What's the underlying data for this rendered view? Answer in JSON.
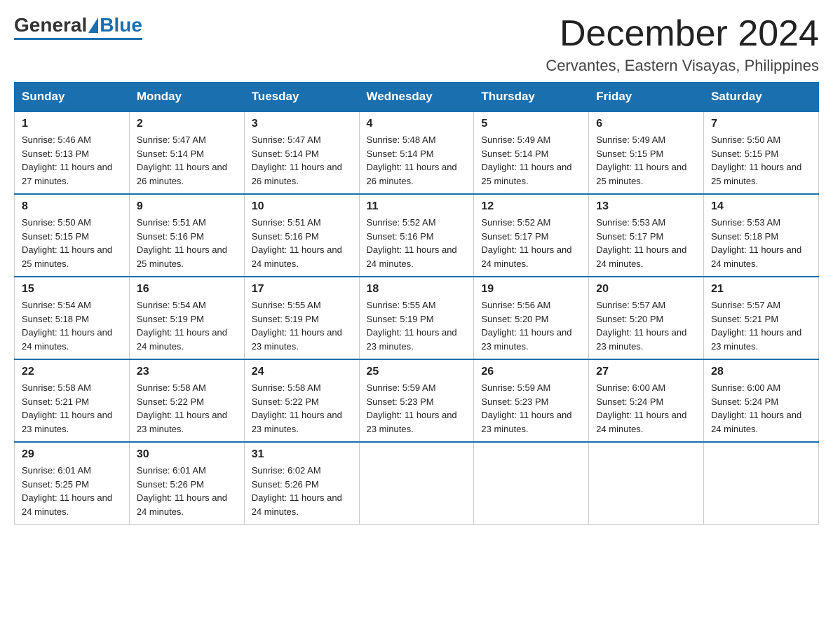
{
  "logo": {
    "general": "General",
    "blue": "Blue"
  },
  "title": "December 2024",
  "subtitle": "Cervantes, Eastern Visayas, Philippines",
  "days_of_week": [
    "Sunday",
    "Monday",
    "Tuesday",
    "Wednesday",
    "Thursday",
    "Friday",
    "Saturday"
  ],
  "weeks": [
    [
      {
        "day": "1",
        "sunrise": "5:46 AM",
        "sunset": "5:13 PM",
        "daylight": "11 hours and 27 minutes."
      },
      {
        "day": "2",
        "sunrise": "5:47 AM",
        "sunset": "5:14 PM",
        "daylight": "11 hours and 26 minutes."
      },
      {
        "day": "3",
        "sunrise": "5:47 AM",
        "sunset": "5:14 PM",
        "daylight": "11 hours and 26 minutes."
      },
      {
        "day": "4",
        "sunrise": "5:48 AM",
        "sunset": "5:14 PM",
        "daylight": "11 hours and 26 minutes."
      },
      {
        "day": "5",
        "sunrise": "5:49 AM",
        "sunset": "5:14 PM",
        "daylight": "11 hours and 25 minutes."
      },
      {
        "day": "6",
        "sunrise": "5:49 AM",
        "sunset": "5:15 PM",
        "daylight": "11 hours and 25 minutes."
      },
      {
        "day": "7",
        "sunrise": "5:50 AM",
        "sunset": "5:15 PM",
        "daylight": "11 hours and 25 minutes."
      }
    ],
    [
      {
        "day": "8",
        "sunrise": "5:50 AM",
        "sunset": "5:15 PM",
        "daylight": "11 hours and 25 minutes."
      },
      {
        "day": "9",
        "sunrise": "5:51 AM",
        "sunset": "5:16 PM",
        "daylight": "11 hours and 25 minutes."
      },
      {
        "day": "10",
        "sunrise": "5:51 AM",
        "sunset": "5:16 PM",
        "daylight": "11 hours and 24 minutes."
      },
      {
        "day": "11",
        "sunrise": "5:52 AM",
        "sunset": "5:16 PM",
        "daylight": "11 hours and 24 minutes."
      },
      {
        "day": "12",
        "sunrise": "5:52 AM",
        "sunset": "5:17 PM",
        "daylight": "11 hours and 24 minutes."
      },
      {
        "day": "13",
        "sunrise": "5:53 AM",
        "sunset": "5:17 PM",
        "daylight": "11 hours and 24 minutes."
      },
      {
        "day": "14",
        "sunrise": "5:53 AM",
        "sunset": "5:18 PM",
        "daylight": "11 hours and 24 minutes."
      }
    ],
    [
      {
        "day": "15",
        "sunrise": "5:54 AM",
        "sunset": "5:18 PM",
        "daylight": "11 hours and 24 minutes."
      },
      {
        "day": "16",
        "sunrise": "5:54 AM",
        "sunset": "5:19 PM",
        "daylight": "11 hours and 24 minutes."
      },
      {
        "day": "17",
        "sunrise": "5:55 AM",
        "sunset": "5:19 PM",
        "daylight": "11 hours and 23 minutes."
      },
      {
        "day": "18",
        "sunrise": "5:55 AM",
        "sunset": "5:19 PM",
        "daylight": "11 hours and 23 minutes."
      },
      {
        "day": "19",
        "sunrise": "5:56 AM",
        "sunset": "5:20 PM",
        "daylight": "11 hours and 23 minutes."
      },
      {
        "day": "20",
        "sunrise": "5:57 AM",
        "sunset": "5:20 PM",
        "daylight": "11 hours and 23 minutes."
      },
      {
        "day": "21",
        "sunrise": "5:57 AM",
        "sunset": "5:21 PM",
        "daylight": "11 hours and 23 minutes."
      }
    ],
    [
      {
        "day": "22",
        "sunrise": "5:58 AM",
        "sunset": "5:21 PM",
        "daylight": "11 hours and 23 minutes."
      },
      {
        "day": "23",
        "sunrise": "5:58 AM",
        "sunset": "5:22 PM",
        "daylight": "11 hours and 23 minutes."
      },
      {
        "day": "24",
        "sunrise": "5:58 AM",
        "sunset": "5:22 PM",
        "daylight": "11 hours and 23 minutes."
      },
      {
        "day": "25",
        "sunrise": "5:59 AM",
        "sunset": "5:23 PM",
        "daylight": "11 hours and 23 minutes."
      },
      {
        "day": "26",
        "sunrise": "5:59 AM",
        "sunset": "5:23 PM",
        "daylight": "11 hours and 23 minutes."
      },
      {
        "day": "27",
        "sunrise": "6:00 AM",
        "sunset": "5:24 PM",
        "daylight": "11 hours and 24 minutes."
      },
      {
        "day": "28",
        "sunrise": "6:00 AM",
        "sunset": "5:24 PM",
        "daylight": "11 hours and 24 minutes."
      }
    ],
    [
      {
        "day": "29",
        "sunrise": "6:01 AM",
        "sunset": "5:25 PM",
        "daylight": "11 hours and 24 minutes."
      },
      {
        "day": "30",
        "sunrise": "6:01 AM",
        "sunset": "5:26 PM",
        "daylight": "11 hours and 24 minutes."
      },
      {
        "day": "31",
        "sunrise": "6:02 AM",
        "sunset": "5:26 PM",
        "daylight": "11 hours and 24 minutes."
      },
      null,
      null,
      null,
      null
    ]
  ]
}
